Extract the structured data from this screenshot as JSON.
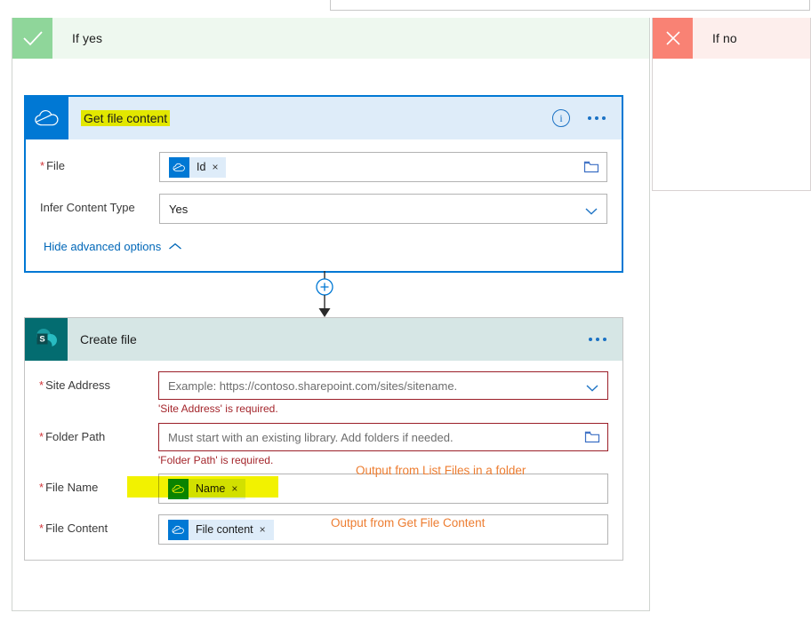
{
  "branches": {
    "yes": {
      "label": "If yes",
      "icon": "check-icon",
      "accent": "#8fd69a",
      "background": "#eef8ef"
    },
    "no": {
      "label": "If no",
      "icon": "close-icon",
      "accent": "#f98274",
      "background": "#fdeeec"
    }
  },
  "cards": [
    {
      "id": "get-file-content",
      "title": "Get file content",
      "title_highlighted": true,
      "connector_app": "onedrive",
      "app_icon": "onedrive-cloud-icon",
      "app_icon_color": "#0078d4",
      "selected": true,
      "header_actions": [
        "info-icon",
        "more-options-icon"
      ],
      "fields": [
        {
          "label": "File",
          "required": true,
          "control": "token",
          "token": {
            "label": "Id",
            "icon": "onedrive-cloud-icon",
            "remove": "×"
          },
          "trailing_icon": "folder-picker-icon"
        },
        {
          "label": "Infer Content Type",
          "required": false,
          "control": "dropdown",
          "value": "Yes",
          "trailing_icon": "chevron-down-icon"
        }
      ],
      "advanced_options_link": "Hide advanced options",
      "advanced_options_icon": "chevron-up-icon"
    },
    {
      "id": "create-file",
      "title": "Create file",
      "title_highlighted": false,
      "connector_app": "sharepoint",
      "app_icon": "sharepoint-icon",
      "app_icon_color": "#036c70",
      "selected": false,
      "header_actions": [
        "more-options-icon"
      ],
      "fields": [
        {
          "label": "Site Address",
          "required": true,
          "control": "dropdown",
          "placeholder": "Example: https://contoso.sharepoint.com/sites/sitename.",
          "trailing_icon": "chevron-down-icon",
          "error": "'Site Address' is required."
        },
        {
          "label": "Folder Path",
          "required": true,
          "control": "text",
          "placeholder": "Must start with an existing library. Add folders if needed.",
          "trailing_icon": "folder-picker-icon",
          "error": "'Folder Path' is required."
        },
        {
          "label": "File Name",
          "required": true,
          "control": "token",
          "token": {
            "label": "Name",
            "icon": "onedrive-cloud-icon",
            "remove": "×"
          },
          "highlighted": true
        },
        {
          "label": "File Content",
          "required": true,
          "control": "token",
          "token": {
            "label": "File content",
            "icon": "onedrive-cloud-icon",
            "remove": "×"
          }
        }
      ]
    }
  ],
  "annotations": [
    {
      "text": "Output from List Files in a folder",
      "color": "#ed7d31"
    },
    {
      "text": "Output from Get File Content",
      "color": "#ed7d31"
    }
  ],
  "connector": {
    "add_step_icon": "plus-circle-icon",
    "arrow_icon": "arrow-down-icon",
    "color": "#0078d4"
  },
  "colors": {
    "accent_blue": "#0078d4",
    "selected_card_fill": "#deecf9",
    "sharepoint_teal": "#036c70",
    "error_red": "#a4262c",
    "error_border": "#9b1f28",
    "highlight_yellow": "#f2f200",
    "annotation_orange": "#ed7d31"
  }
}
